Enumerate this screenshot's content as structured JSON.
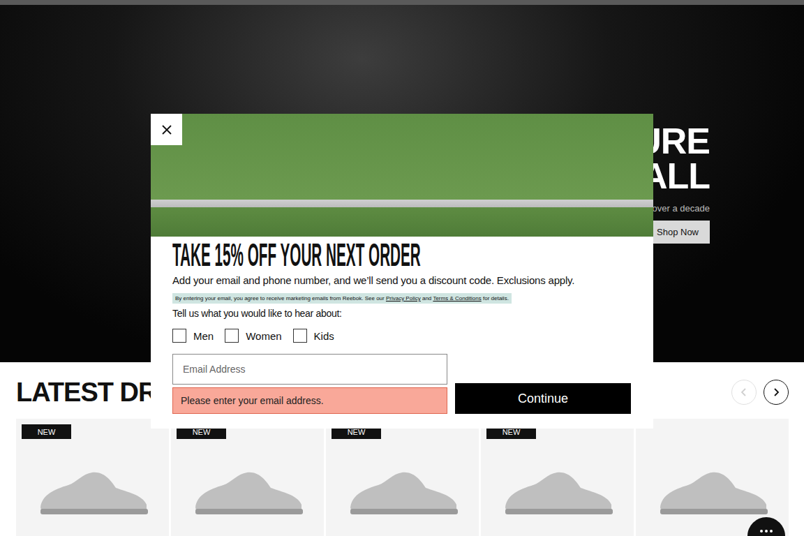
{
  "hero": {
    "heading_lines": [
      "URE",
      "ALL"
    ],
    "subtitle": "over a decade",
    "cta": "Shop Now"
  },
  "modal": {
    "heading": "TAKE 15% OFF YOUR NEXT ORDER",
    "description": "Add your email and phone number, and we’ll send you a discount code. Exclusions apply.",
    "consent": [
      {
        "text": "By entering your email, you agree to receive marketing emails from Reebok. See our ",
        "link": false
      },
      {
        "text": "Privacy Policy",
        "link": true
      },
      {
        "text": " and ",
        "link": false
      },
      {
        "text": "Terms & Conditions",
        "link": true
      },
      {
        "text": " for details.",
        "link": false
      }
    ],
    "interests_label": "Tell us what you would like to hear about:",
    "interests": [
      {
        "label": "Men",
        "checked": false
      },
      {
        "label": "Women",
        "checked": false
      },
      {
        "label": "Kids",
        "checked": false
      }
    ],
    "email_placeholder": "Email Address",
    "error": "Please enter your email address.",
    "submit": "Continue"
  },
  "latest": {
    "title": "LATEST DRO",
    "prev_disabled": true,
    "next_disabled": false,
    "products": [
      {
        "badge": "NEW"
      },
      {
        "badge": "NEW"
      },
      {
        "badge": "NEW"
      },
      {
        "badge": "NEW"
      },
      {
        "badge": null
      }
    ]
  }
}
